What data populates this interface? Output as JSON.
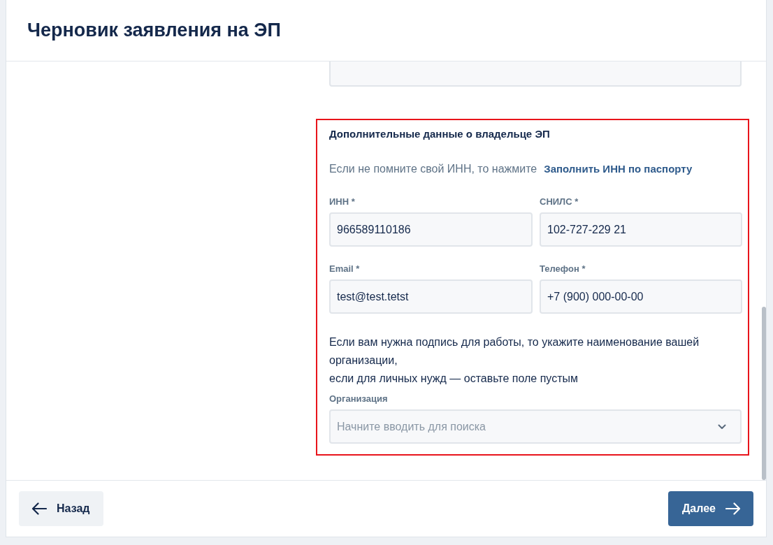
{
  "window": {
    "title": "Черновик заявления на ЭП"
  },
  "section": {
    "title": "Дополнительные данные о владельце ЭП",
    "hint": {
      "text": "Если не помните свой ИНН, то нажмите",
      "link": "Заполнить ИНН по паспорту"
    },
    "fields": [
      {
        "label": "ИНН *",
        "value": "966589110186"
      },
      {
        "label": "СНИЛС *",
        "value": "102-727-229 21"
      },
      {
        "label": "Email *",
        "value": "test@test.tetst"
      },
      {
        "label": "Телефон *",
        "value": "+7 (900) 000-00-00"
      }
    ],
    "note": "Если вам нужна подпись для работы, то укажите наименование вашей организации,\nесли для личных нужд — оставьте поле пустым",
    "organization": {
      "label": "Организация",
      "placeholder": "Начните вводить для поиска"
    }
  },
  "buttons": [
    {
      "label": "Назад",
      "kind": "back"
    },
    {
      "label": "Далее",
      "kind": "next"
    }
  ]
}
